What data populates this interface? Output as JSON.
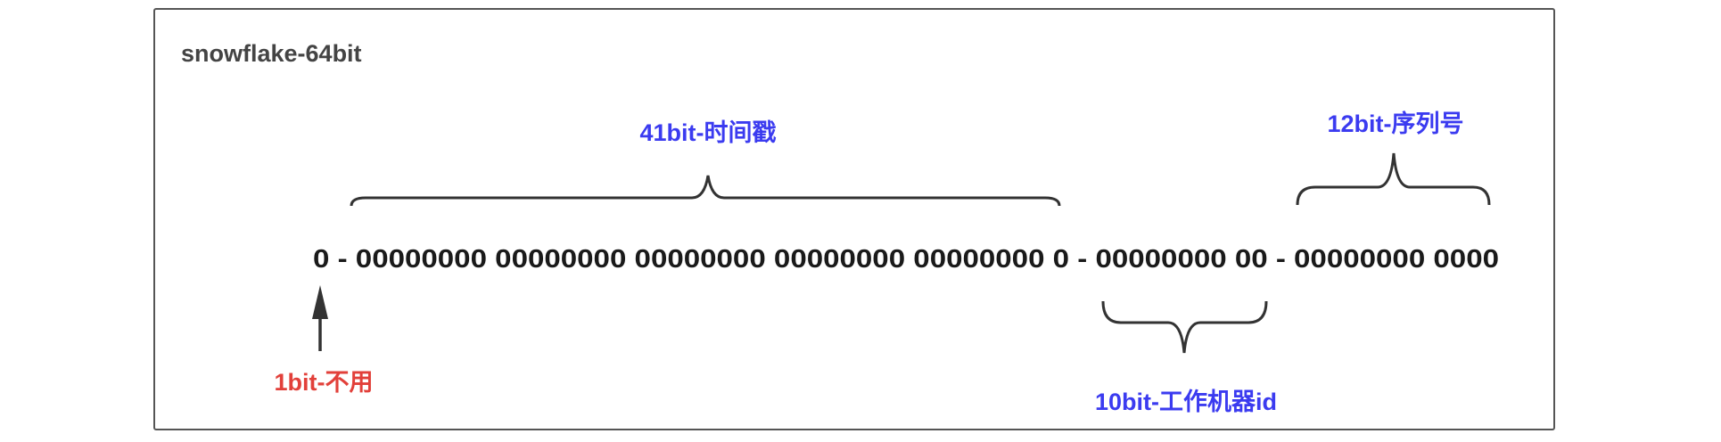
{
  "title": "snowflake-64bit",
  "bits_row": "0 - 00000000 00000000 00000000 00000000 00000000 0 - 00000000 00 - 00000000 0000",
  "labels": {
    "sign": "1bit-不用",
    "timestamp": "41bit-时间戳",
    "worker": "10bit-工作机器id",
    "sequence": "12bit-序列号"
  },
  "colors": {
    "sign": "#e2403a",
    "blue": "#3b3bf0",
    "text": "#1a1a1a",
    "title": "#444444"
  }
}
